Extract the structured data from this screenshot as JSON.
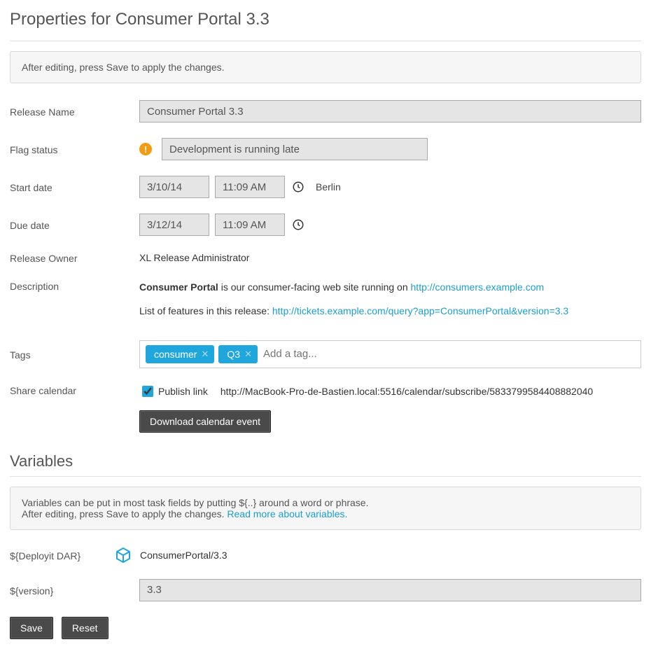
{
  "page": {
    "title": "Properties for Consumer Portal 3.3",
    "banner": "After editing, press Save to apply the changes."
  },
  "labels": {
    "release_name": "Release Name",
    "flag_status": "Flag status",
    "start_date": "Start date",
    "due_date": "Due date",
    "release_owner": "Release Owner",
    "description": "Description",
    "tags": "Tags",
    "share_calendar": "Share calendar",
    "publish_link": "Publish link",
    "variables_title": "Variables",
    "save": "Save",
    "reset": "Reset",
    "download_cal": "Download calendar event"
  },
  "fields": {
    "release_name": "Consumer Portal 3.3",
    "flag_status_text": "Development is running late",
    "start_date": "3/10/14",
    "start_time": "11:09 AM",
    "timezone": "Berlin",
    "due_date": "3/12/14",
    "due_time": "11:09 AM",
    "release_owner": "XL Release Administrator",
    "description": {
      "bold": "Consumer Portal",
      "text1": " is our consumer-facing web site running on ",
      "link1": "http://consumers.example.com",
      "text2": "List of features in this release: ",
      "link2": "http://tickets.example.com/query?app=ConsumerPortal&version=3.3"
    },
    "tags": {
      "0": "consumer",
      "1": "Q3"
    },
    "tag_placeholder": "Add a tag...",
    "publish_checked": true,
    "publish_url": "http://MacBook-Pro-de-Bastien.local:5516/calendar/subscribe/5833799584408882040"
  },
  "variables": {
    "banner_line1": "Variables can be put in most task fields by putting ${..} around a word or phrase.",
    "banner_line2": "After editing, press Save to apply the changes. ",
    "banner_link": "Read more about variables.",
    "items": {
      "0": {
        "name": "${Deployit DAR}",
        "value": "ConsumerPortal/3.3"
      },
      "1": {
        "name": "${version}",
        "value": "3.3"
      }
    }
  }
}
